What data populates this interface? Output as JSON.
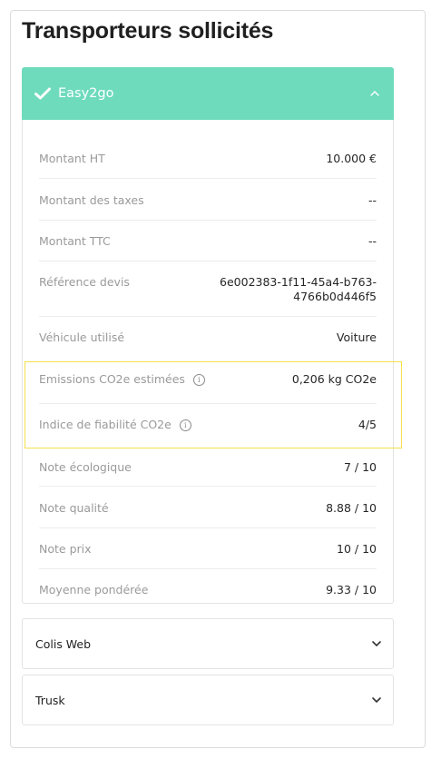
{
  "title": "Transporteurs sollicités",
  "carriers": {
    "expanded": {
      "name": "Easy2go",
      "rows": [
        {
          "label": "Montant HT",
          "value": "10.000 €"
        },
        {
          "label": "Montant des taxes",
          "value": "--"
        },
        {
          "label": "Montant TTC",
          "value": "--"
        },
        {
          "label": "Référence devis",
          "value": "6e002383-1f11-45a4-b763-",
          "value2": "4766b0d446f5"
        },
        {
          "label": "Véhicule utilisé",
          "value": "Voiture"
        },
        {
          "label": "Emissions CO2e estimées",
          "value": "0,206 kg CO2e",
          "info": "i"
        },
        {
          "label": "Indice de fiabilité CO2e",
          "value": "4/5",
          "info": "i"
        },
        {
          "label": "Note écologique",
          "value": "7 / 10"
        },
        {
          "label": "Note qualité",
          "value": "8.88 / 10"
        },
        {
          "label": "Note prix",
          "value": "10 / 10"
        },
        {
          "label": "Moyenne pondérée",
          "value": "9.33 / 10"
        }
      ]
    },
    "collapsed": [
      {
        "name": "Colis Web"
      },
      {
        "name": "Trusk"
      }
    ]
  },
  "icons": {
    "header_check": "check-icon",
    "header_chevron": "chevron-up-icon",
    "collapsed_chevron": "chevron-down-icon",
    "info": "info-icon"
  },
  "colors": {
    "accent": "#6edbbd",
    "highlight": "#f4e04a"
  }
}
